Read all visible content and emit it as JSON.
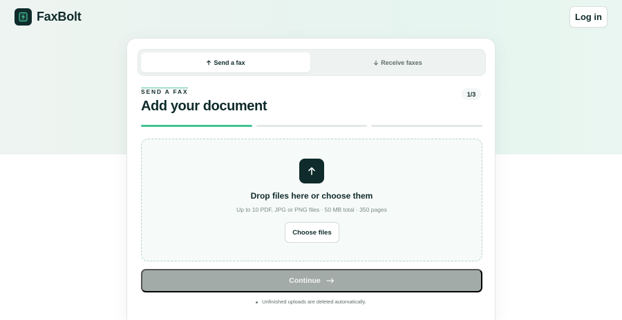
{
  "brand": {
    "name": "FaxBolt",
    "accent": "#41c393",
    "dark": "#0f2b2b"
  },
  "header": {
    "login_label": "Log in"
  },
  "tabs": [
    {
      "label": "Send a fax",
      "icon": "arrow-up-icon",
      "active": true
    },
    {
      "label": "Receive faxes",
      "icon": "arrow-down-icon",
      "active": false
    }
  ],
  "step": {
    "eyebrow": "SEND A FAX",
    "title": "Add your document",
    "badge": "1/3",
    "current": 1,
    "total": 3
  },
  "dropzone": {
    "title": "Drop files here or choose them",
    "subtitle": "Up to 10 PDF, JPG or PNG files · 50 MB total · 350 pages",
    "choose_label": "Choose files",
    "icon": "upload-arrow-icon"
  },
  "continue": {
    "label": "Continue",
    "icon": "arrow-right-icon",
    "disabled": true
  },
  "note": "Unfinished uploads are deleted automatically."
}
